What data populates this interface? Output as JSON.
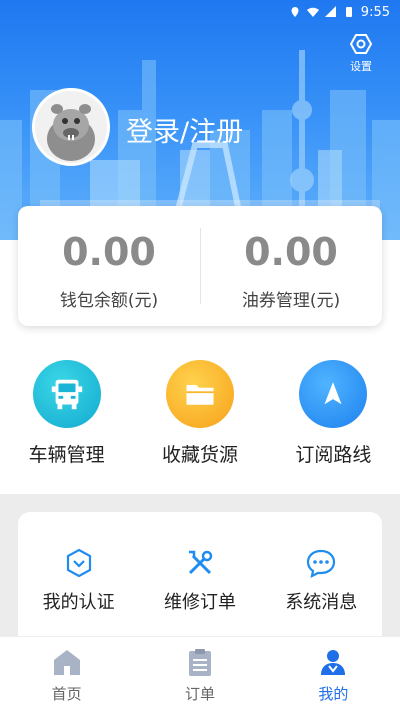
{
  "status_bar": {
    "time": "9:55"
  },
  "header": {
    "settings_label": "设置",
    "login_label": "登录/注册"
  },
  "wallet": {
    "balance": {
      "amount": "0.00",
      "label": "钱包余额(元)"
    },
    "coupon": {
      "amount": "0.00",
      "label": "油券管理(元)"
    }
  },
  "services": [
    {
      "label": "车辆管理",
      "icon": "truck-icon"
    },
    {
      "label": "收藏货源",
      "icon": "folder-icon"
    },
    {
      "label": "订阅路线",
      "icon": "navigation-arrow-icon"
    }
  ],
  "more_services": [
    {
      "label": "我的认证",
      "icon": "verify-shield-icon"
    },
    {
      "label": "维修订单",
      "icon": "repair-tools-icon"
    },
    {
      "label": "系统消息",
      "icon": "message-bubble-icon"
    }
  ],
  "bottom_nav": [
    {
      "label": "首页",
      "icon": "home-icon",
      "active": false
    },
    {
      "label": "订单",
      "icon": "clipboard-icon",
      "active": false
    },
    {
      "label": "我的",
      "icon": "user-icon",
      "active": true
    }
  ],
  "colors": {
    "accent": "#1f6fe8",
    "header_top": "#1f78f0",
    "header_bottom": "#5fb0fb",
    "inactive_nav": "#a9b3c6"
  }
}
